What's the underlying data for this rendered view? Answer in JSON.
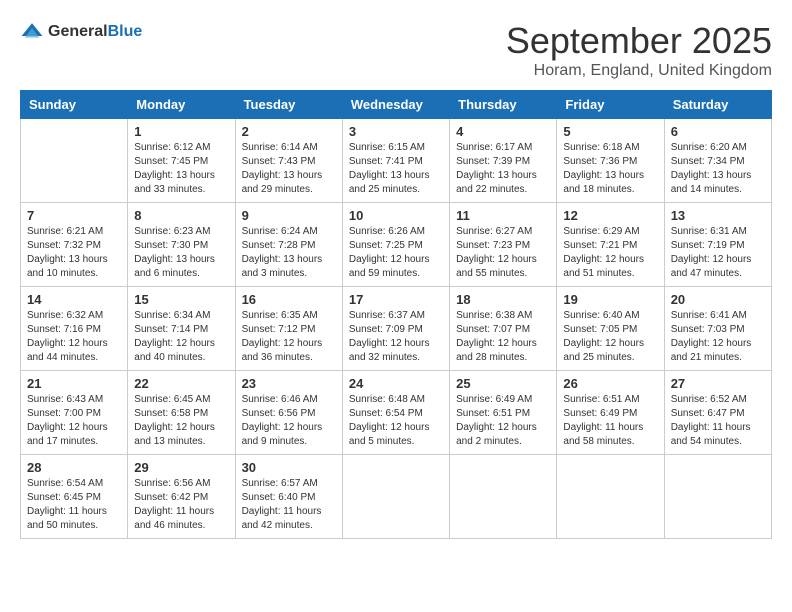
{
  "logo": {
    "general": "General",
    "blue": "Blue"
  },
  "header": {
    "month": "September 2025",
    "location": "Horam, England, United Kingdom"
  },
  "weekdays": [
    "Sunday",
    "Monday",
    "Tuesday",
    "Wednesday",
    "Thursday",
    "Friday",
    "Saturday"
  ],
  "weeks": [
    [
      {
        "day": "",
        "info": ""
      },
      {
        "day": "1",
        "info": "Sunrise: 6:12 AM\nSunset: 7:45 PM\nDaylight: 13 hours\nand 33 minutes."
      },
      {
        "day": "2",
        "info": "Sunrise: 6:14 AM\nSunset: 7:43 PM\nDaylight: 13 hours\nand 29 minutes."
      },
      {
        "day": "3",
        "info": "Sunrise: 6:15 AM\nSunset: 7:41 PM\nDaylight: 13 hours\nand 25 minutes."
      },
      {
        "day": "4",
        "info": "Sunrise: 6:17 AM\nSunset: 7:39 PM\nDaylight: 13 hours\nand 22 minutes."
      },
      {
        "day": "5",
        "info": "Sunrise: 6:18 AM\nSunset: 7:36 PM\nDaylight: 13 hours\nand 18 minutes."
      },
      {
        "day": "6",
        "info": "Sunrise: 6:20 AM\nSunset: 7:34 PM\nDaylight: 13 hours\nand 14 minutes."
      }
    ],
    [
      {
        "day": "7",
        "info": "Sunrise: 6:21 AM\nSunset: 7:32 PM\nDaylight: 13 hours\nand 10 minutes."
      },
      {
        "day": "8",
        "info": "Sunrise: 6:23 AM\nSunset: 7:30 PM\nDaylight: 13 hours\nand 6 minutes."
      },
      {
        "day": "9",
        "info": "Sunrise: 6:24 AM\nSunset: 7:28 PM\nDaylight: 13 hours\nand 3 minutes."
      },
      {
        "day": "10",
        "info": "Sunrise: 6:26 AM\nSunset: 7:25 PM\nDaylight: 12 hours\nand 59 minutes."
      },
      {
        "day": "11",
        "info": "Sunrise: 6:27 AM\nSunset: 7:23 PM\nDaylight: 12 hours\nand 55 minutes."
      },
      {
        "day": "12",
        "info": "Sunrise: 6:29 AM\nSunset: 7:21 PM\nDaylight: 12 hours\nand 51 minutes."
      },
      {
        "day": "13",
        "info": "Sunrise: 6:31 AM\nSunset: 7:19 PM\nDaylight: 12 hours\nand 47 minutes."
      }
    ],
    [
      {
        "day": "14",
        "info": "Sunrise: 6:32 AM\nSunset: 7:16 PM\nDaylight: 12 hours\nand 44 minutes."
      },
      {
        "day": "15",
        "info": "Sunrise: 6:34 AM\nSunset: 7:14 PM\nDaylight: 12 hours\nand 40 minutes."
      },
      {
        "day": "16",
        "info": "Sunrise: 6:35 AM\nSunset: 7:12 PM\nDaylight: 12 hours\nand 36 minutes."
      },
      {
        "day": "17",
        "info": "Sunrise: 6:37 AM\nSunset: 7:09 PM\nDaylight: 12 hours\nand 32 minutes."
      },
      {
        "day": "18",
        "info": "Sunrise: 6:38 AM\nSunset: 7:07 PM\nDaylight: 12 hours\nand 28 minutes."
      },
      {
        "day": "19",
        "info": "Sunrise: 6:40 AM\nSunset: 7:05 PM\nDaylight: 12 hours\nand 25 minutes."
      },
      {
        "day": "20",
        "info": "Sunrise: 6:41 AM\nSunset: 7:03 PM\nDaylight: 12 hours\nand 21 minutes."
      }
    ],
    [
      {
        "day": "21",
        "info": "Sunrise: 6:43 AM\nSunset: 7:00 PM\nDaylight: 12 hours\nand 17 minutes."
      },
      {
        "day": "22",
        "info": "Sunrise: 6:45 AM\nSunset: 6:58 PM\nDaylight: 12 hours\nand 13 minutes."
      },
      {
        "day": "23",
        "info": "Sunrise: 6:46 AM\nSunset: 6:56 PM\nDaylight: 12 hours\nand 9 minutes."
      },
      {
        "day": "24",
        "info": "Sunrise: 6:48 AM\nSunset: 6:54 PM\nDaylight: 12 hours\nand 5 minutes."
      },
      {
        "day": "25",
        "info": "Sunrise: 6:49 AM\nSunset: 6:51 PM\nDaylight: 12 hours\nand 2 minutes."
      },
      {
        "day": "26",
        "info": "Sunrise: 6:51 AM\nSunset: 6:49 PM\nDaylight: 11 hours\nand 58 minutes."
      },
      {
        "day": "27",
        "info": "Sunrise: 6:52 AM\nSunset: 6:47 PM\nDaylight: 11 hours\nand 54 minutes."
      }
    ],
    [
      {
        "day": "28",
        "info": "Sunrise: 6:54 AM\nSunset: 6:45 PM\nDaylight: 11 hours\nand 50 minutes."
      },
      {
        "day": "29",
        "info": "Sunrise: 6:56 AM\nSunset: 6:42 PM\nDaylight: 11 hours\nand 46 minutes."
      },
      {
        "day": "30",
        "info": "Sunrise: 6:57 AM\nSunset: 6:40 PM\nDaylight: 11 hours\nand 42 minutes."
      },
      {
        "day": "",
        "info": ""
      },
      {
        "day": "",
        "info": ""
      },
      {
        "day": "",
        "info": ""
      },
      {
        "day": "",
        "info": ""
      }
    ]
  ]
}
